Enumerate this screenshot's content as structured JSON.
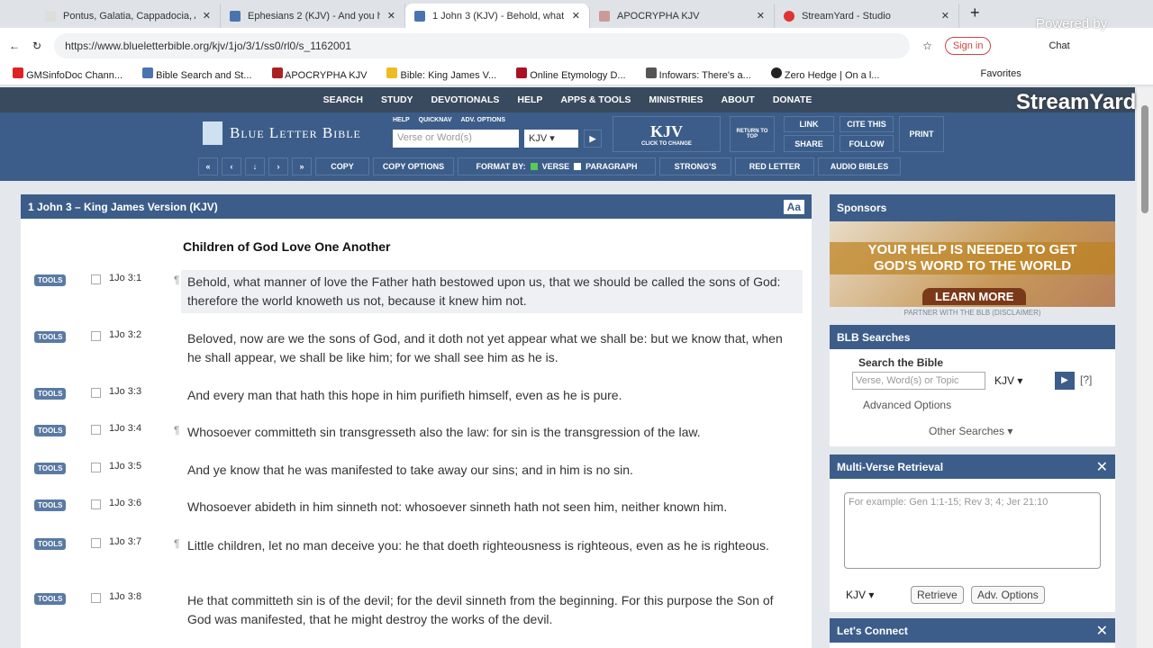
{
  "browser": {
    "tabs": [
      "Pontus, Galatia, Cappadocia, A",
      "Ephesians 2 (KJV) - And you h",
      "1 John 3 (KJV) - Behold, what",
      "APOCRYPHA KJV",
      "StreamYard - Studio"
    ],
    "url": "https://www.blueletterbible.org/kjv/1jo/3/1/ss0/rl0/s_1162001",
    "sign_in": "Sign in",
    "chat": "Chat",
    "bookmarks": [
      "GMSinfoDoc Chann...",
      "Bible Search and St...",
      "APOCRYPHA KJV",
      "Bible: King James V...",
      "Online Etymology D...",
      "Infowars: There's a...",
      "Zero Hedge | On a l..."
    ],
    "favorites": "Favorites"
  },
  "overlay": {
    "powered": "Powered by",
    "brand": "StreamYard"
  },
  "nav": [
    "SEARCH",
    "STUDY",
    "DEVOTIONALS",
    "HELP",
    "APPS & TOOLS",
    "MINISTRIES",
    "ABOUT",
    "DONATE"
  ],
  "header": {
    "logo": "Blue Letter Bible",
    "help": "HELP",
    "quicknav": "QUICKNAV",
    "adv": "ADV. OPTIONS",
    "search_placeholder": "Verse or Word(s)",
    "version": "KJV",
    "kjv": "KJV",
    "click_change": "CLICK TO CHANGE",
    "return_top": "RETURN TO TOP",
    "link": "LINK",
    "share": "SHARE",
    "cite": "CITE THIS",
    "follow": "FOLLOW",
    "print": "PRINT",
    "toolbar": [
      "COPY",
      "COPY OPTIONS",
      "FORMAT BY:",
      "VERSE",
      "PARAGRAPH",
      "STRONG'S",
      "RED LETTER",
      "AUDIO BIBLES"
    ]
  },
  "main": {
    "title": "1 John 3 – King James Version (KJV)",
    "aa": "Aa",
    "heading": "Children of God Love One Another",
    "tools": "TOOLS",
    "verses": [
      {
        "ref": "1Jo 3:1",
        "p": "¶",
        "text": "Behold, what manner of love the Father hath bestowed upon us, that we should be called the sons of God: therefore the world knoweth us not, because it knew him not."
      },
      {
        "ref": "1Jo 3:2",
        "p": "",
        "text": "Beloved, now are we the sons of God, and it doth not yet appear what we shall be: but we know that, when he shall appear, we shall be like him; for we shall see him as he is."
      },
      {
        "ref": "1Jo 3:3",
        "p": "",
        "text": "And every man that hath this hope in him purifieth himself, even as he is pure."
      },
      {
        "ref": "1Jo 3:4",
        "p": "¶",
        "text": "Whosoever committeth sin transgresseth also the law: for sin is the transgression of the law."
      },
      {
        "ref": "1Jo 3:5",
        "p": "",
        "text": "And ye know that he was manifested to take away our sins; and in him is no sin."
      },
      {
        "ref": "1Jo 3:6",
        "p": "",
        "text": "Whosoever abideth in him sinneth not: whosoever sinneth hath not seen him, neither known him."
      },
      {
        "ref": "1Jo 3:7",
        "p": "¶",
        "text": "Little children, let no man deceive you: he that doeth righteousness is righteous, even as he is righteous."
      },
      {
        "ref": "1Jo 3:8",
        "p": "",
        "text": "He that committeth sin is of the devil; for the devil sinneth from the beginning. For this purpose the Son of God was manifested, that he might destroy the works of the devil."
      }
    ]
  },
  "sidebar": {
    "sponsors": "Sponsors",
    "ad1": "YOUR HELP IS NEEDED TO GET",
    "ad2": "GOD'S WORD TO THE WORLD",
    "learn": "LEARN MORE",
    "partner": "PARTNER WITH THE BLB",
    "disclaimer": "(DISCLAIMER)",
    "searches": "BLB Searches",
    "search_bible": "Search the Bible",
    "search_ph": "Verse, Word(s) or Topic",
    "version": "KJV",
    "help": "[?]",
    "advanced": "Advanced Options",
    "other": "Other Searches ▾",
    "mvr": "Multi-Verse Retrieval",
    "mvr_ph": "For example: Gen 1:1-15; Rev 3; 4; Jer 21:10",
    "retrieve": "Retrieve",
    "adv_options": "Adv. Options",
    "connect": "Let's Connect"
  }
}
